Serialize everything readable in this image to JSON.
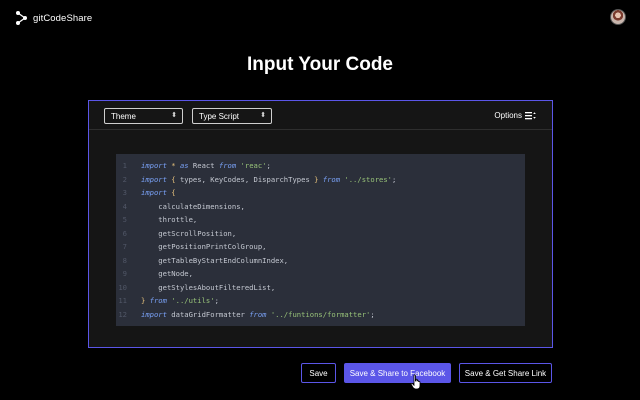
{
  "app": {
    "name": "gitCodeShare",
    "logo_icon": "share-nodes-icon",
    "avatar_icon": "user-avatar"
  },
  "page": {
    "title": "Input Your Code"
  },
  "editor": {
    "theme_select": {
      "selected": "Theme"
    },
    "language_select": {
      "selected": "Type Script"
    },
    "options_label": "Options",
    "options_icon": "menu-sort-icon",
    "lines": [
      {
        "num": "1",
        "text": "import * as React from 'reac';"
      },
      {
        "num": "2",
        "text": "import { types, KeyCodes, DisparchTypes } from '../stores';"
      },
      {
        "num": "3",
        "text": "import {"
      },
      {
        "num": "4",
        "text": "    calculateDimensions,"
      },
      {
        "num": "5",
        "text": "    throttle,"
      },
      {
        "num": "6",
        "text": "    getScrollPosition,"
      },
      {
        "num": "7",
        "text": "    getPositionPrintColGroup,"
      },
      {
        "num": "8",
        "text": "    getTableByStartEndColumnIndex,"
      },
      {
        "num": "9",
        "text": "    getNode,"
      },
      {
        "num": "10",
        "text": "    getStylesAboutFilteredList,"
      },
      {
        "num": "11",
        "text": "} from '../utils';"
      },
      {
        "num": "12",
        "text": "import dataGridFormatter from '../funtions/formatter';"
      }
    ]
  },
  "actions": {
    "save": "Save",
    "save_share_facebook": "Save & Share to Facebook",
    "save_get_link": "Save & Get Share Link"
  },
  "colors": {
    "accent": "#5b56e8",
    "background": "#000000",
    "code_bg": "#2b2f3a"
  }
}
